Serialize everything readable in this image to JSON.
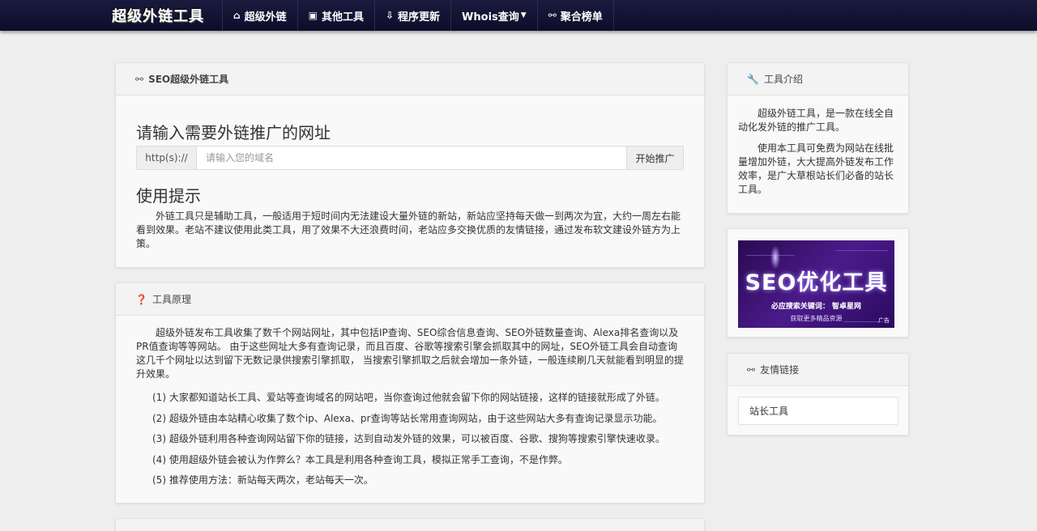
{
  "brand": "超级外链工具",
  "nav": [
    {
      "icon": "home-icon",
      "glyph": "⌂",
      "label": "超级外链"
    },
    {
      "icon": "box-icon",
      "glyph": "▣",
      "label": "其他工具"
    },
    {
      "icon": "update-icon",
      "glyph": "⇩",
      "label": "程序更新"
    },
    {
      "icon": "",
      "glyph": "",
      "label": "Whois查询",
      "dropdown": true
    },
    {
      "icon": "link-icon",
      "glyph": "⚯",
      "label": "聚合榜单"
    }
  ],
  "main_panel": {
    "heading": "SEO超级外链工具",
    "input_title": "请输入需要外链推广的网址",
    "addon": "http(s)://",
    "placeholder": "请输入您的域名",
    "value": "",
    "submit": "开始推广",
    "tips_title": "使用提示",
    "tips_text": "外链工具只是辅助工具，一般适用于短时间内无法建设大量外链的新站，新站应坚持每天做一到两次为宜，大约一周左右能看到效果。老站不建议使用此类工具，用了效果不大还浪费时间，老站应多交换优质的友情链接，通过发布软文建设外链方为上策。"
  },
  "principle_panel": {
    "heading": "工具原理",
    "intro": "超级外链发布工具收集了数千个网站网址，其中包括IP查询、SEO综合信息查询、SEO外链数量查询、Alexa排名查询以及PR值查询等等网站。 由于这些网址大多有查询记录，而且百度、谷歌等搜索引擎会抓取其中的网址，SEO外链工具会自动查询这几千个网址以达到留下无数记录供搜索引擎抓取， 当搜索引擎抓取之后就会增加一条外链，一般连续刷几天就能看到明显的提升效果。",
    "items": [
      "(1)  大家都知道站长工具、爱站等查询域名的网站吧，当你查询过他就会留下你的网站链接，这样的链接就形成了外链。",
      "(2)  超级外链由本站精心收集了数个ip、Alexa、pr查询等站长常用查询网站，由于这些网站大多有查询记录显示功能。",
      "(3)  超级外链利用各种查询网站留下你的链接，达到自动发外链的效果，可以被百度、谷歌、搜狗等搜索引擎快速收录。",
      "(4)  使用超级外链会被认为作弊么？本工具是利用各种查询工具，模拟正常手工查询，不是作弊。",
      "(5)  推荐使用方法：新站每天两次，老站每天一次。"
    ]
  },
  "intro_panel": {
    "heading": "工具介绍",
    "p1": "超级外链工具，是一款在线全自动化发外链的推广工具。",
    "p2": "使用本工具可免费为网站在线批量增加外链，大大提高外链发布工作效率，是广大草根站长们必备的站长工具。"
  },
  "ad": {
    "main": "SEO优化工具",
    "sub": "必应搜索关键词： 智卓星网",
    "foot": "获取更多精品资源",
    "tag": "广告"
  },
  "friends_panel": {
    "heading": "友情链接",
    "links": [
      "站长工具"
    ]
  }
}
